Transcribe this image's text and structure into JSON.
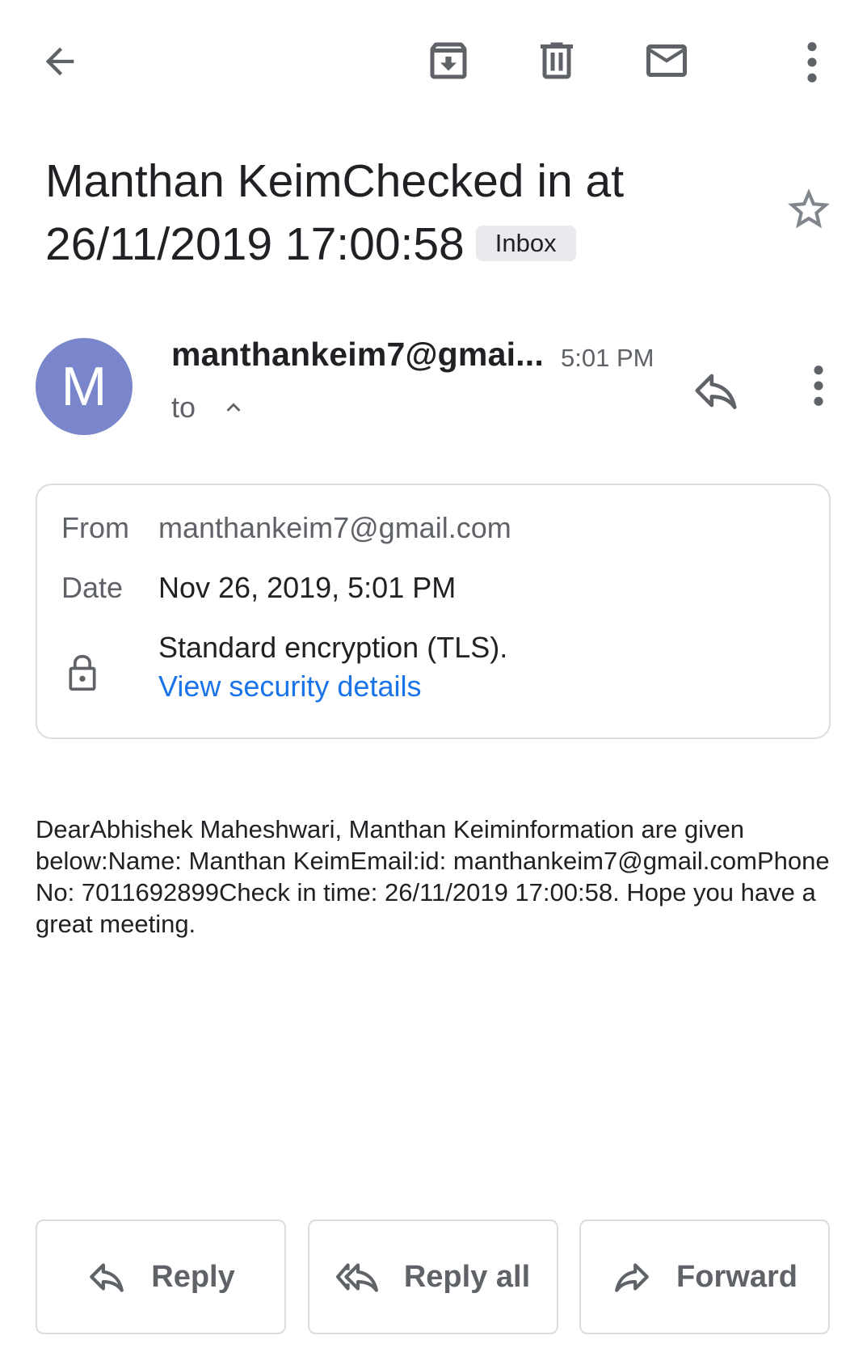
{
  "toolbar": {
    "back_icon": "arrow-back-icon",
    "archive_icon": "archive-icon",
    "delete_icon": "trash-icon",
    "mark_unread_icon": "mail-icon",
    "more_icon": "more-vert-icon"
  },
  "subject": {
    "text": "Manthan KeimChecked in at 26/11/2019 17:00:58",
    "label": "Inbox"
  },
  "message": {
    "avatar_letter": "M",
    "avatar_color": "#7986cb",
    "sender": "manthankeim7@gmai...",
    "time": "5:01 PM",
    "to_label": "to"
  },
  "details": {
    "from_label": "From",
    "from_value": "manthankeim7@gmail.com",
    "date_label": "Date",
    "date_value": "Nov 26, 2019, 5:01 PM",
    "encryption": "Standard encryption (TLS).",
    "security_link": "View security details"
  },
  "body": {
    "text": "DearAbhishek Maheshwari, Manthan Keiminformation are given below:Name: Manthan KeimEmail:id: manthankeim7@gmail.comPhone No: 7011692899Check in time: 26/11/2019 17:00:58. Hope you have a great meeting."
  },
  "actions": {
    "reply": "Reply",
    "reply_all": "Reply all",
    "forward": "Forward"
  },
  "colors": {
    "link": "#1a73e8",
    "icon": "#5f6368",
    "border": "#dadce0"
  }
}
